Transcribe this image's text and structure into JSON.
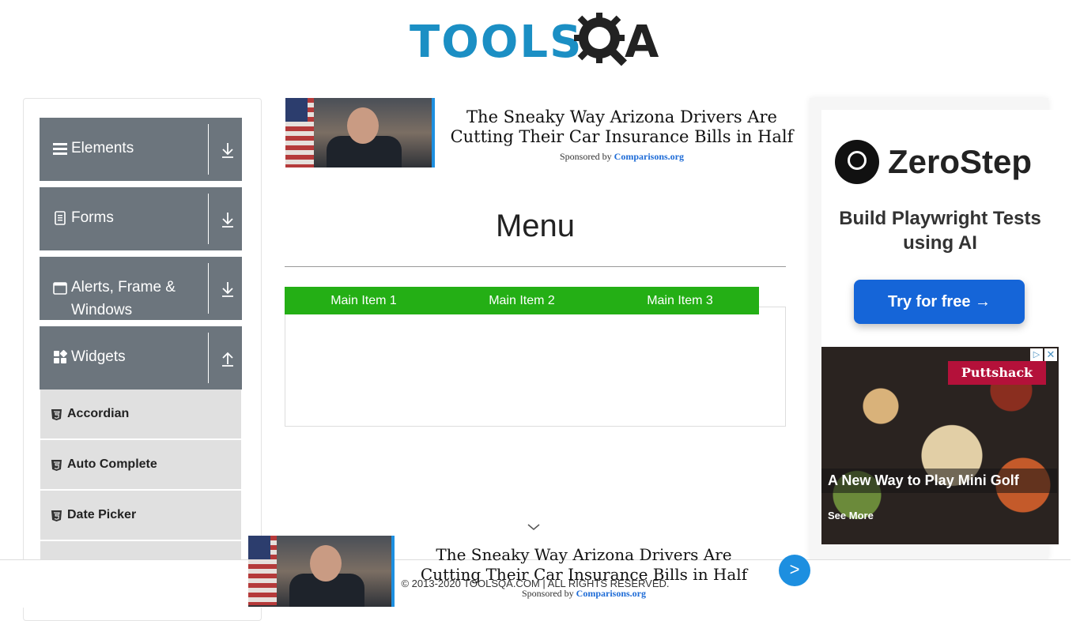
{
  "header": {
    "logo_text": "TOOLS",
    "logo_suffix": "A"
  },
  "sidebar": {
    "groups": [
      {
        "title": "Elements",
        "icon": "hamburger-icon",
        "arrow": "down"
      },
      {
        "title": "Forms",
        "icon": "document-icon",
        "arrow": "down"
      },
      {
        "title": "Alerts, Frame & Windows",
        "icon": "window-icon",
        "arrow": "down"
      },
      {
        "title": "Widgets",
        "icon": "widgets-icon",
        "arrow": "up"
      }
    ],
    "sub_items": [
      "Accordian",
      "Auto Complete",
      "Date Picker",
      ""
    ]
  },
  "ad_top": {
    "headline": "The Sneaky Way Arizona Drivers Are Cutting Their Car Insurance Bills in Half",
    "sponsored_by": "Sponsored by",
    "sponsor": "Comparisons.org"
  },
  "main": {
    "title": "Menu",
    "menu_items": [
      "Main Item 1",
      "Main Item 2",
      "Main Item 3"
    ]
  },
  "ad_right_1": {
    "brand": "ZeroStep",
    "tagline": "Build Playwright Tests using AI",
    "cta": "Try for free →",
    "accent": "#1565d8"
  },
  "ad_right_2": {
    "brand": "Puttshack",
    "headline": "A New Way to Play Mini Golf",
    "cta": "See More",
    "info": "▷",
    "close": "✕",
    "accent": "#b4113a"
  },
  "footer": {
    "copyright": "© 2013-2020 TOOLSQA.COM | ALL RIGHTS RESERVED."
  },
  "ad_bottom": {
    "headline": "The Sneaky Way Arizona Drivers Are Cutting Their Car Insurance Bills in Half",
    "sponsored_by": "Sponsored by",
    "sponsor": "Comparisons.org",
    "next": ">"
  },
  "colors": {
    "menu_green": "#24af15",
    "sidebar_header": "#6c757d",
    "sidebar_item": "#e0e0e0",
    "logo_blue": "#1b8fc4"
  }
}
